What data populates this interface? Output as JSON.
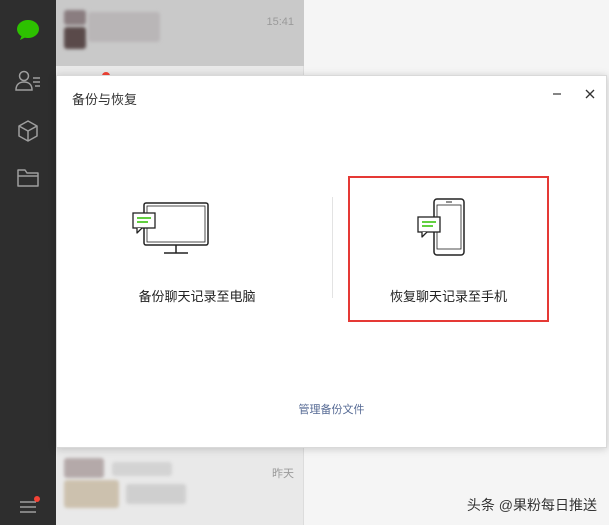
{
  "chat_list": {
    "items": [
      {
        "time": "15:41"
      },
      {
        "time": "昨天"
      }
    ]
  },
  "dialog": {
    "title": "备份与恢复",
    "backup_to_pc_label": "备份聊天记录至电脑",
    "restore_to_phone_label": "恢复聊天记录至手机",
    "manage_backup_link": "管理备份文件"
  },
  "watermark": "头条 @果粉每日推送",
  "colors": {
    "accent_green": "#2dc100",
    "highlight_red": "#e53935",
    "link_blue": "#576b95",
    "sidebar_bg": "#2e2e2e"
  },
  "icons": {
    "sidebar": [
      "chat-icon",
      "contacts-icon",
      "favorites-icon",
      "files-icon",
      "menu-icon"
    ],
    "dialog": [
      "minimize-icon",
      "close-icon",
      "monitor-icon",
      "phone-icon"
    ]
  }
}
